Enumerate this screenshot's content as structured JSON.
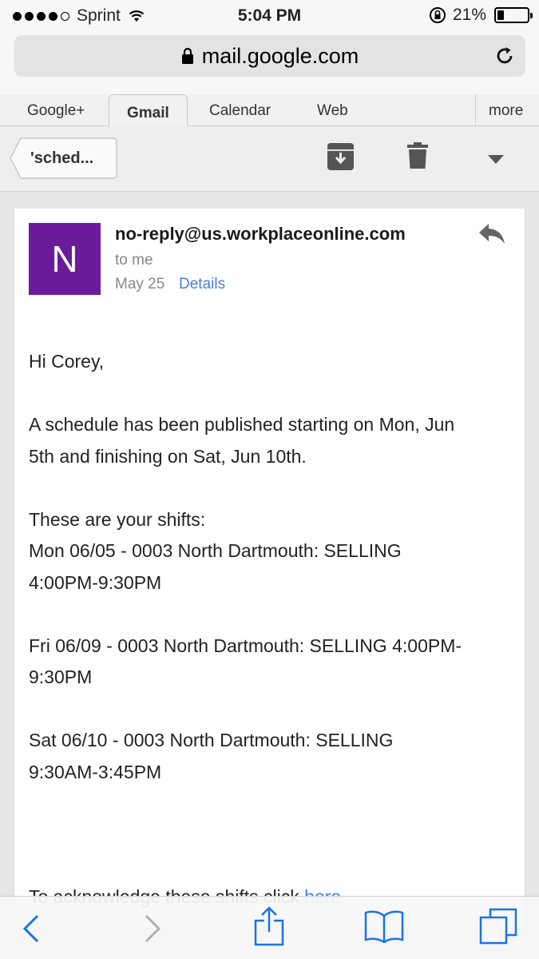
{
  "status_bar": {
    "carrier": "Sprint",
    "time": "5:04 PM",
    "battery_percent": "21%",
    "battery_level": 0.21,
    "signal_bars_filled": 4,
    "icons": [
      "wifi-icon",
      "rotation-lock-icon",
      "battery-icon"
    ]
  },
  "url_bar": {
    "url": "mail.google.com",
    "icons": [
      "lock-icon",
      "reload-icon"
    ]
  },
  "google_tabs": {
    "items": [
      "Google+",
      "Gmail",
      "Calendar",
      "Web"
    ],
    "active": "Gmail",
    "more": "more"
  },
  "toolbar": {
    "back_label": "'sched...",
    "icons": [
      "archive-icon",
      "trash-icon",
      "dropdown-arrow-icon"
    ]
  },
  "email": {
    "avatar_letter": "N",
    "avatar_color": "#6a1b9a",
    "sender": "no-reply@us.workplaceonline.com",
    "recipient": "to me",
    "date": "May 25",
    "details_link": "Details",
    "body": {
      "greeting": "Hi Corey,",
      "intro_line1": "A schedule has been published starting on Mon, Jun",
      "intro_line2": "5th and finishing on Sat, Jun 10th.",
      "shifts_header": "These are your shifts:",
      "shift1_line1": "Mon 06/05 - 0003 North Dartmouth: SELLING",
      "shift1_line2": "4:00PM-9:30PM",
      "shift2_line1": "Fri 06/09 - 0003 North Dartmouth: SELLING 4:00PM-",
      "shift2_line2": "9:30PM",
      "shift3_line1": "Sat 06/10 - 0003 North Dartmouth: SELLING",
      "shift3_line2": "9:30AM-3:45PM",
      "acknowledge_text": "To acknowledge these shifts click",
      "acknowledge_link": "here"
    }
  },
  "bottom_bar": {
    "icons": [
      "back-arrow-icon",
      "forward-arrow-icon",
      "share-icon",
      "bookmarks-icon",
      "tabs-icon"
    ]
  },
  "colors": {
    "link_blue": "#4a7ed8",
    "ios_blue": "#1a73e8"
  }
}
